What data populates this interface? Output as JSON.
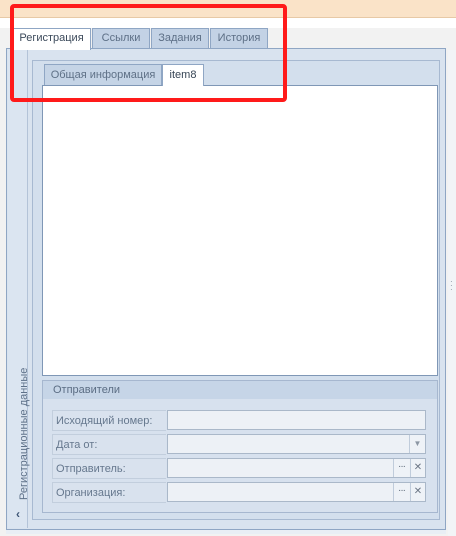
{
  "outer_tabs": [
    {
      "label": "Регистрация",
      "active": true
    },
    {
      "label": "Ссылки",
      "active": false
    },
    {
      "label": "Задания",
      "active": false
    },
    {
      "label": "История",
      "active": false
    }
  ],
  "side_panel": {
    "label": "Регистрационные данные",
    "collapse_glyph": "‹"
  },
  "inner_tabs": [
    {
      "label": "Общая информация",
      "active": false
    },
    {
      "label": "item8",
      "active": true
    }
  ],
  "senders_group": {
    "title": "Отправители",
    "fields": [
      {
        "label": "Исходящий номер:",
        "value": ""
      },
      {
        "label": "Дата от:",
        "value": ""
      },
      {
        "label": "Отправитель:",
        "value": ""
      },
      {
        "label": "Организация:",
        "value": ""
      }
    ]
  },
  "buttons": {
    "ellipsis": "···",
    "clear": "✕",
    "dropdown": "▼"
  },
  "colors": {
    "highlight": "#ff1a1a",
    "tab_blue": "#c3d2e5",
    "border_blue": "#8fa6c4"
  },
  "icons": [
    "chevron-left-icon",
    "ellipsis-icon",
    "clear-icon",
    "dropdown-arrow-icon",
    "splitter-grip-icon"
  ]
}
